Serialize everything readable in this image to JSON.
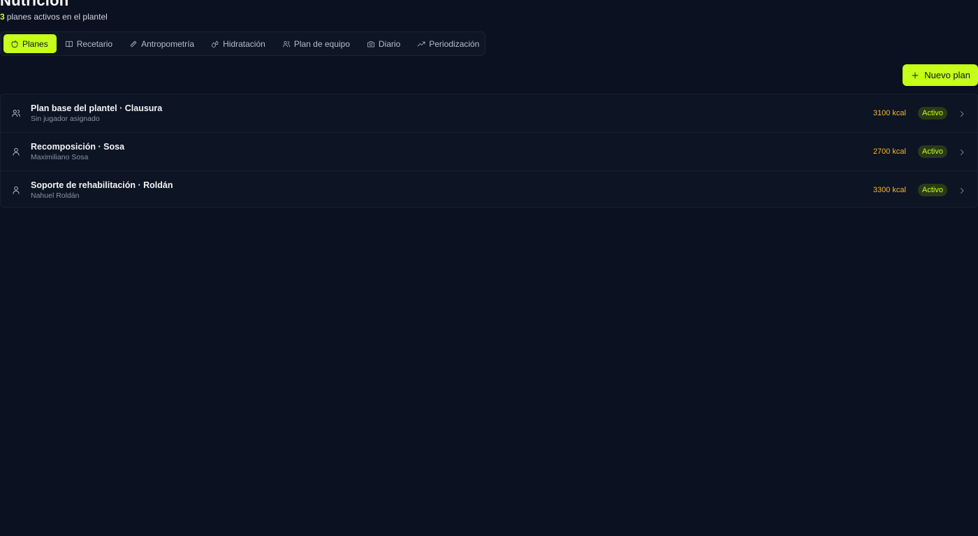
{
  "header": {
    "title": "Nutrición",
    "active_count": "3",
    "subtitle": "planes activos en el plantel"
  },
  "tabs": [
    {
      "label": "Planes",
      "icon": "apple-icon",
      "active": true
    },
    {
      "label": "Recetario",
      "icon": "book-icon",
      "active": false
    },
    {
      "label": "Antropometría",
      "icon": "ruler-icon",
      "active": false
    },
    {
      "label": "Hidratación",
      "icon": "droplets-icon",
      "active": false
    },
    {
      "label": "Plan de equipo",
      "icon": "users-icon",
      "active": false
    },
    {
      "label": "Diario",
      "icon": "camera-icon",
      "active": false
    },
    {
      "label": "Periodización",
      "icon": "trending-up-icon",
      "active": false
    }
  ],
  "actions": {
    "new_plan_label": "Nuevo plan"
  },
  "plans": [
    {
      "name": "Plan base del plantel · Clausura",
      "player": "Sin jugador asignado",
      "kcal": "3100 kcal",
      "status": "Activo",
      "icon": "users-icon"
    },
    {
      "name": "Recomposición · Sosa",
      "player": "Maximiliano Sosa",
      "kcal": "2700 kcal",
      "status": "Activo",
      "icon": "user-icon"
    },
    {
      "name": "Soporte de rehabilitación · Roldán",
      "player": "Nahuel Roldán",
      "kcal": "3300 kcal",
      "status": "Activo",
      "icon": "user-icon"
    }
  ],
  "colors": {
    "background": "#0b1120",
    "accent": "#c6ff1a",
    "kcal": "#f5b829",
    "status_bg": "#293a1a"
  }
}
